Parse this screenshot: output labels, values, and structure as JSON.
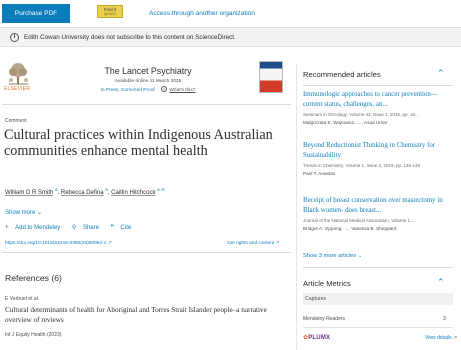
{
  "topbar": {
    "purchase_label": "Purchase PDF",
    "findit_label": "Find it",
    "findit_sub": "@ ECU",
    "access_label": "Access through another organization"
  },
  "banner": {
    "text": "Edith Cowan University does not subscribe to this content on ScienceDirect."
  },
  "journal": {
    "publisher": "ELSEVIER",
    "title": "The Lancet Psychiatry",
    "available": "Available online 11 March 2025",
    "in_press": "In Press, Corrected Proof",
    "whats_this": "What's this?"
  },
  "article": {
    "type": "Comment",
    "title": "Cultural practices within Indigenous Australian communities enhance mental health",
    "authors": [
      {
        "name": "William D R Smith",
        "marks": "a"
      },
      {
        "name": "Rebecca Defina",
        "marks": "a"
      },
      {
        "name": "Caitlin Hitchcock",
        "marks": "a ✉"
      }
    ],
    "show_more": "Show more",
    "actions": {
      "add": "Add to Mendeley",
      "share": "Share",
      "cite": "Cite"
    },
    "doi": "https://doi.org/10.1016/S2215-0366(25)00064-1",
    "rights": "Get rights and content"
  },
  "references": {
    "heading": "References (6)",
    "first": {
      "authors": "E Verbunt et al.",
      "title": "Cultural determinants of health for Aboriginal and Torres Strait Islander people–a narrative overview of reviews",
      "journal": "Int J Equity Health (2023)"
    }
  },
  "sidebar": {
    "recommended_heading": "Recommended articles",
    "recommended": [
      {
        "title": "Immunologic approaches to cancer prevention—current status, challenges, an...",
        "meta": "Seminars in Oncology, Volume 43, Issue 1, 2016, pp. 16...",
        "authors": "Malgorzata E. Wojtowicz, …, Asad Umar"
      },
      {
        "title": "Beyond Reductionist Thinking in Chemistry for Sustainability",
        "meta": "Trends in Chemistry, Volume 1, Issue 2, 2019, pp. 145-148",
        "authors": "Paul T. Anastas"
      },
      {
        "title": "Receipt of breast conservation over mastectomy in Black women- does breast...",
        "meta": "Journal of the National Medical Association, Volume 1...",
        "authors": "Bridget A. Oppong, …, Vanessa B. Sheppard"
      }
    ],
    "show_more_articles": "Show 3 more articles",
    "metrics_heading": "Article Metrics",
    "captures_label": "Captures",
    "mendeley_label": "Mendeley Readers",
    "mendeley_value": "3",
    "plumx": "PLUMX",
    "view_details": "View details"
  },
  "colors": {
    "accent": "#0c7dbb",
    "brand_orange": "#e9711c",
    "plumx": "#6a2b8a"
  }
}
